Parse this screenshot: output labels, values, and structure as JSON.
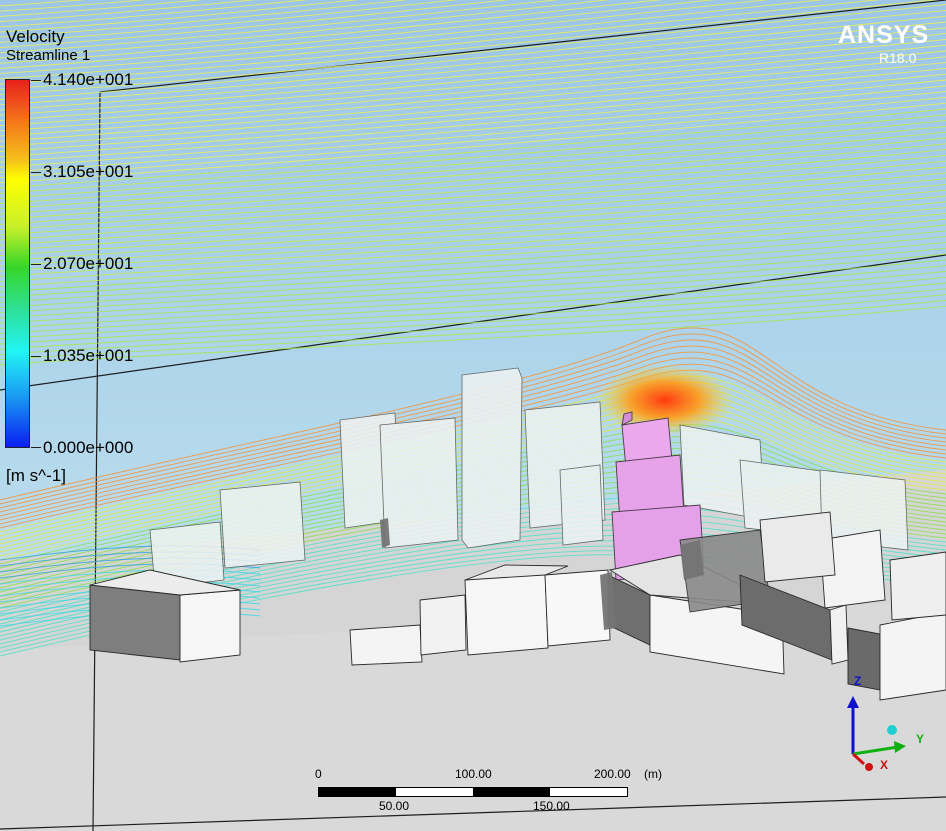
{
  "legend": {
    "title": "Velocity",
    "subtitle": "Streamline 1",
    "ticks": [
      "4.140e+001",
      "3.105e+001",
      "2.070e+001",
      "1.035e+001",
      "0.000e+000"
    ],
    "unit": "[m s^-1]"
  },
  "branding": {
    "logo": "ANSYS",
    "version": "R18.0"
  },
  "scale_bar": {
    "top_labels": [
      "0",
      "100.00",
      "200.00",
      "(m)"
    ],
    "bottom_labels": [
      "50.00",
      "150.00"
    ]
  },
  "axes": {
    "z_label": "Z",
    "y_label": "Y",
    "x_label": "X"
  },
  "colors": {
    "sky": "#a6cbe8",
    "ground": "#d7d7d7",
    "building": "#f4f4f4",
    "building_shadow": "#7c7c7c",
    "highlight_building": "#e8a6ea"
  }
}
